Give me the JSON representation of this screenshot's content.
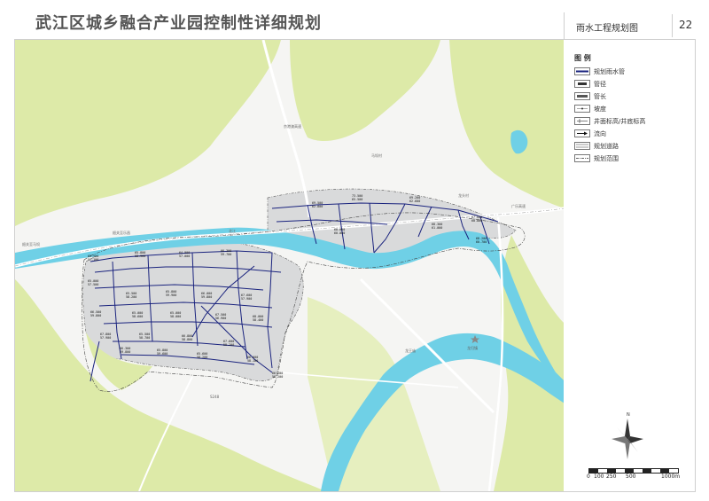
{
  "header": {
    "title": "武江区城乡融合产业园控制性详细规划",
    "sheet_name": "雨水工程规划图",
    "sheet_number": "22"
  },
  "legend": {
    "title": "图 例",
    "items": [
      {
        "label": "规划雨水管",
        "icon": "planned-storm-pipe"
      },
      {
        "label": "管径",
        "icon": "pipe-diameter"
      },
      {
        "label": "管长",
        "icon": "pipe-length"
      },
      {
        "label": "坡度",
        "icon": "slope"
      },
      {
        "label": "井面标高/井底标高",
        "icon": "manhole-elevation"
      },
      {
        "label": "流向",
        "icon": "flow-direction"
      },
      {
        "label": "规划道路",
        "icon": "planned-road"
      },
      {
        "label": "规划范围",
        "icon": "planning-boundary"
      }
    ]
  },
  "map_labels": {
    "place_1": "马坝村",
    "place_2": "龙头村",
    "place_3": "龙归镇",
    "road_1": "韶关至马坝",
    "road_2": "京港澳高速",
    "road_3": "广乐高速",
    "road_4": "韶关至乐昌",
    "road_5": "S248",
    "road_6": "龙王庙",
    "river": "北江"
  },
  "pipe_labels": [
    "65.500\n57.100",
    "65.800\n58.900",
    "64.900\n57.000",
    "66.300\n59.700",
    "65.000\n57.500",
    "65.500\n58.200",
    "65.800\n59.900",
    "66.000\n59.800",
    "67.600\n57.900",
    "66.500\n59.800",
    "65.000\n58.600",
    "65.000\n58.000",
    "67.500\n56.900",
    "68.000\n58.400",
    "67.800\n57.900",
    "65.500\n58.700",
    "66.800\n58.800",
    "67.600\n58.200",
    "66.300\n59.800",
    "65.800\n59.600",
    "65.600\n58.200",
    "66.000\n58.100",
    "66.200\n58.200",
    "69.500\n62.800",
    "73.500\n65.500",
    "68.000\n60.000",
    "69.200\n62.600",
    "68.300\n61.000",
    "67.800\n60.800",
    "68.200\n60.700"
  ],
  "north": {
    "label": "N"
  },
  "scale": {
    "ticks": [
      "0",
      "100",
      "250",
      "500",
      "1000m"
    ]
  },
  "colors": {
    "hill": "#ddeaa8",
    "zone": "#d9dadb",
    "river": "#6fd0e6",
    "pipe": "#1a237e",
    "road": "#ffffff",
    "boundary": "#555555"
  }
}
